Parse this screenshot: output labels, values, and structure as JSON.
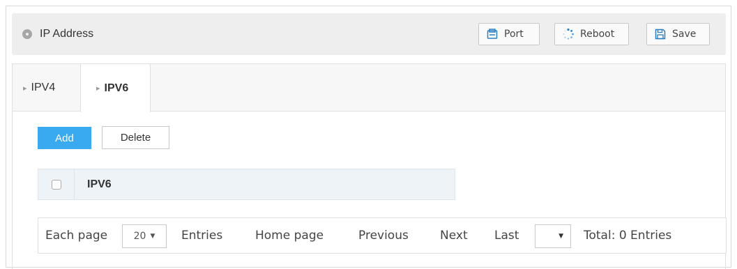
{
  "header": {
    "title": "IP Address",
    "icon": "gear-dot-icon",
    "buttons": {
      "port": "Port",
      "reboot": "Reboot",
      "save": "Save"
    }
  },
  "tabs": [
    {
      "label": "IPV4",
      "active": false
    },
    {
      "label": "IPV6",
      "active": true
    }
  ],
  "actions": {
    "add": "Add",
    "delete": "Delete"
  },
  "table": {
    "columns": [
      "IPV6"
    ],
    "rows": []
  },
  "pagination": {
    "each_page_label": "Each page",
    "page_size": "20",
    "entries_label": "Entries",
    "home": "Home page",
    "previous": "Previous",
    "next": "Next",
    "last": "Last",
    "current_page": "",
    "total": "Total: 0 Entries"
  },
  "colors": {
    "accent": "#39aaf0",
    "header_bg": "#eeeeee",
    "table_head_bg": "#eef3f8"
  }
}
